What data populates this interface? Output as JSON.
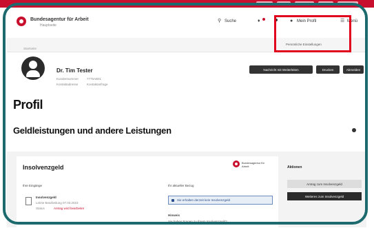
{
  "header": {
    "logo_title": "Bundesagentur für Arbeit",
    "logo_subtitle": "Hauptseite",
    "search_label": "Suche",
    "notification_icon": "bell-icon",
    "profile_label": "Mein Profil",
    "menu_label": "Menü"
  },
  "subbar": {
    "link": "Persönliche Einstellungen"
  },
  "breadcrumb": "Startseite",
  "profile": {
    "name": "Dr. Tim Tester",
    "meta_1a": "Kundennummer",
    "meta_1b": "7775AB01",
    "meta_2a": "Kontaktadresse",
    "meta_2b": "Kontaktanfrage",
    "buttons": [
      "Nachricht mit Weiterleiten",
      "Drucken",
      "Abmelden"
    ]
  },
  "page_title": "Profil",
  "section_title": "Geldleistungen und andere Leistungen",
  "card": {
    "title": "Insolvenzgeld",
    "ba_logo_text": "Bundesagentur für Arbeit",
    "col1_label": "Ihre Eingänge",
    "doc_title": "Insolvenzgeld",
    "doc_line1": "Letzte Bearbeitung 07.03.2023",
    "doc_line2a": "Status",
    "doc_line2b": "Antrag wird bearbeitet",
    "col2_label": "Ihr aktueller Bezug",
    "status_text": "Sie erhalten derzeit kein Insolvenzgeld",
    "col2_label2": "Hinweis",
    "col2_note": "Sie haben Fragen zu Ihrem Insolvenzgeld?"
  },
  "actions": {
    "title": "Aktionen",
    "btn_primary": "Antrag zum Insolvenzgeld",
    "btn_secondary": "Weiteres zum Insolvenzgeld"
  },
  "colors": {
    "brand_red": "#c8102e",
    "frame_teal": "#1d6a6e",
    "highlight_red": "#e0001b"
  }
}
